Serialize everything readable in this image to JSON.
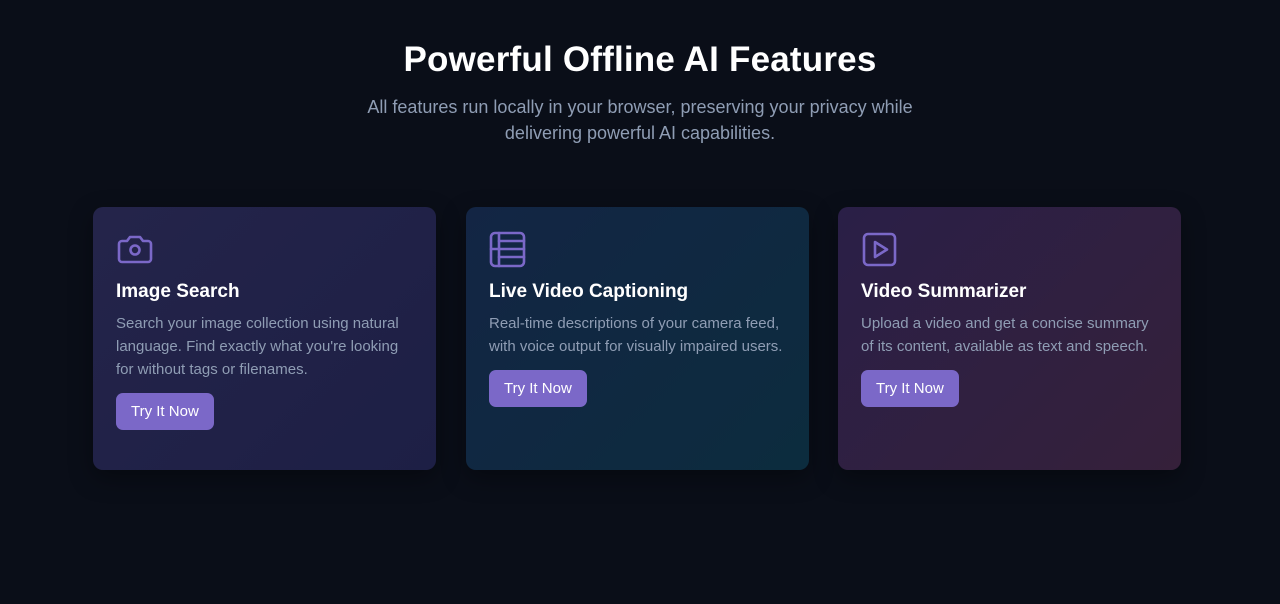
{
  "section": {
    "title": "Powerful Offline AI Features",
    "subtitle": "All features run locally in your browser, preserving your privacy while delivering powerful AI capabilities."
  },
  "accent_color": "#7b68c8",
  "cards": [
    {
      "icon": "camera-icon",
      "title": "Image Search",
      "description": "Search your image collection using natural language. Find exactly what you're looking for without tags or filenames.",
      "button_label": "Try It Now"
    },
    {
      "icon": "video-layout-icon",
      "title": "Live Video Captioning",
      "description": "Real-time descriptions of your camera feed, with voice output for visually impaired users.",
      "button_label": "Try It Now"
    },
    {
      "icon": "play-square-icon",
      "title": "Video Summarizer",
      "description": "Upload a video and get a concise summary of its content, available as text and speech.",
      "button_label": "Try It Now"
    }
  ]
}
